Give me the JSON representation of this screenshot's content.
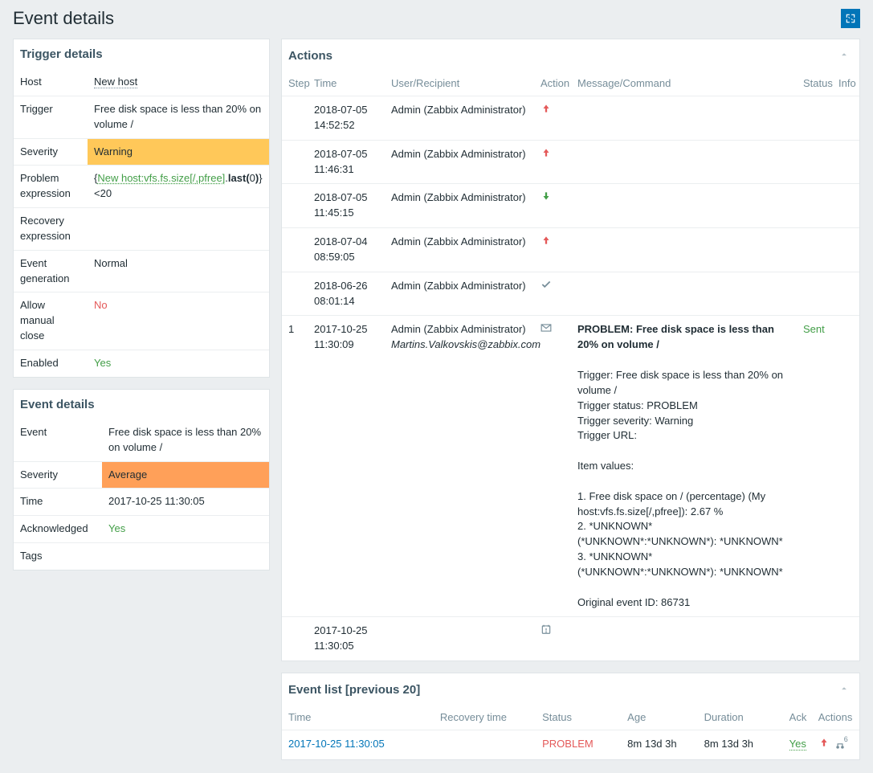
{
  "page": {
    "title": "Event details"
  },
  "trigger": {
    "title": "Trigger details",
    "rows": {
      "host_label": "Host",
      "host_value": "New host",
      "trigger_label": "Trigger",
      "trigger_value": "Free disk space is less than 20% on volume /",
      "severity_label": "Severity",
      "severity_value": "Warning",
      "expr_label": "Problem expression",
      "expr_pre": "{",
      "expr_link": "New host:vfs.fs.size[/,pfree]",
      "expr_mid": ".last(",
      "expr_zero": "0",
      "expr_post": ")}<20",
      "recov_label": "Recovery expression",
      "recov_value": "",
      "gen_label": "Event generation",
      "gen_value": "Normal",
      "allow_label": "Allow manual close",
      "allow_value": "No",
      "enabled_label": "Enabled",
      "enabled_value": "Yes"
    }
  },
  "event": {
    "title": "Event details",
    "rows": {
      "event_label": "Event",
      "event_value": "Free disk space is less than 20% on volume /",
      "severity_label": "Severity",
      "severity_value": "Average",
      "time_label": "Time",
      "time_value": "2017-10-25 11:30:05",
      "ack_label": "Acknowledged",
      "ack_value": "Yes",
      "tags_label": "Tags",
      "tags_value": ""
    }
  },
  "actions": {
    "title": "Actions",
    "headers": {
      "step": "Step",
      "time": "Time",
      "user": "User/Recipient",
      "action": "Action",
      "msg": "Message/Command",
      "status": "Status",
      "info": "Info"
    },
    "rows": [
      {
        "step": "",
        "time": "2018-07-05 14:52:52",
        "user": "Admin (Zabbix Administrator)",
        "icon": "up",
        "msg_title": "",
        "msg_body": "",
        "status": ""
      },
      {
        "step": "",
        "time": "2018-07-05 11:46:31",
        "user": "Admin (Zabbix Administrator)",
        "icon": "up",
        "msg_title": "",
        "msg_body": "",
        "status": ""
      },
      {
        "step": "",
        "time": "2018-07-05 11:45:15",
        "user": "Admin (Zabbix Administrator)",
        "icon": "down",
        "msg_title": "",
        "msg_body": "",
        "status": ""
      },
      {
        "step": "",
        "time": "2018-07-04 08:59:05",
        "user": "Admin (Zabbix Administrator)",
        "icon": "up",
        "msg_title": "",
        "msg_body": "",
        "status": ""
      },
      {
        "step": "",
        "time": "2018-06-26 08:01:14",
        "user": "Admin (Zabbix Administrator)",
        "icon": "check",
        "msg_title": "",
        "msg_body": "",
        "status": ""
      },
      {
        "step": "1",
        "time": "2017-10-25 11:30:09",
        "user": "Admin (Zabbix Administrator)",
        "user2": "Martins.Valkovskis@zabbix.com",
        "icon": "mail",
        "msg_title": "PROBLEM: Free disk space is less than 20% on volume /",
        "msg_body": "Trigger: Free disk space is less than 20% on volume /\nTrigger status: PROBLEM\nTrigger severity: Warning\nTrigger URL:\n\nItem values:\n\n1. Free disk space on / (percentage) (My host:vfs.fs.size[/,pfree]): 2.67 %\n2. *UNKNOWN* (*UNKNOWN*:*UNKNOWN*): *UNKNOWN*\n3. *UNKNOWN* (*UNKNOWN*:*UNKNOWN*): *UNKNOWN*\n\nOriginal event ID: 86731",
        "status": "Sent"
      },
      {
        "step": "",
        "time": "2017-10-25 11:30:05",
        "user": "",
        "icon": "problem",
        "msg_title": "",
        "msg_body": "",
        "status": ""
      }
    ]
  },
  "eventlist": {
    "title": "Event list [previous 20]",
    "headers": {
      "time": "Time",
      "recovery": "Recovery time",
      "status": "Status",
      "age": "Age",
      "duration": "Duration",
      "ack": "Ack",
      "actions": "Actions"
    },
    "rows": [
      {
        "time": "2017-10-25 11:30:05",
        "recovery": "",
        "status": "PROBLEM",
        "age": "8m 13d 3h",
        "duration": "8m 13d 3h",
        "ack": "Yes",
        "actions_count": "6"
      }
    ]
  }
}
